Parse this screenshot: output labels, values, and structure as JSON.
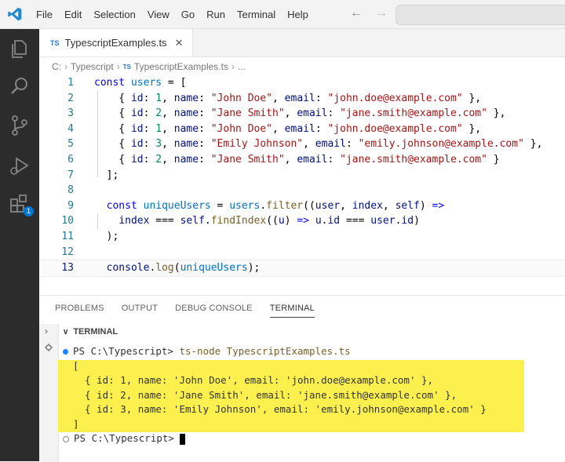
{
  "menu": [
    "File",
    "Edit",
    "Selection",
    "View",
    "Go",
    "Run",
    "Terminal",
    "Help"
  ],
  "nav": {
    "back": "←",
    "forward": "→"
  },
  "tab": {
    "badge": "TS",
    "title": "TypescriptExamples.ts",
    "close": "✕"
  },
  "breadcrumb": {
    "drive": "C:",
    "folder": "Typescript",
    "badge": "TS",
    "file": "TypescriptExamples.ts",
    "more": "..."
  },
  "activity_badge": "1",
  "line_numbers": [
    "1",
    "2",
    "3",
    "4",
    "5",
    "6",
    "7",
    "8",
    "9",
    "10",
    "11",
    "12",
    "13"
  ],
  "panel_tabs": [
    "PROBLEMS",
    "OUTPUT",
    "DEBUG CONSOLE",
    "TERMINAL"
  ],
  "terminal": {
    "header": "TERMINAL",
    "prompt1": "PS C:\\Typescript> ",
    "command": "ts-node TypescriptExamples.ts",
    "open_bracket": "[",
    "out1": "  { id: 1, name: 'John Doe', email: 'john.doe@example.com' },",
    "out2": "  { id: 2, name: 'Jane Smith', email: 'jane.smith@example.com' },",
    "out3": "  { id: 3, name: 'Emily Johnson', email: 'emily.johnson@example.com' }",
    "close_bracket": "]",
    "prompt2": "PS C:\\Typescript> "
  },
  "colors": {
    "highlight": "#fbf04e",
    "activity_bar": "#2c2c2c",
    "ts_blue": "#3178c6"
  }
}
